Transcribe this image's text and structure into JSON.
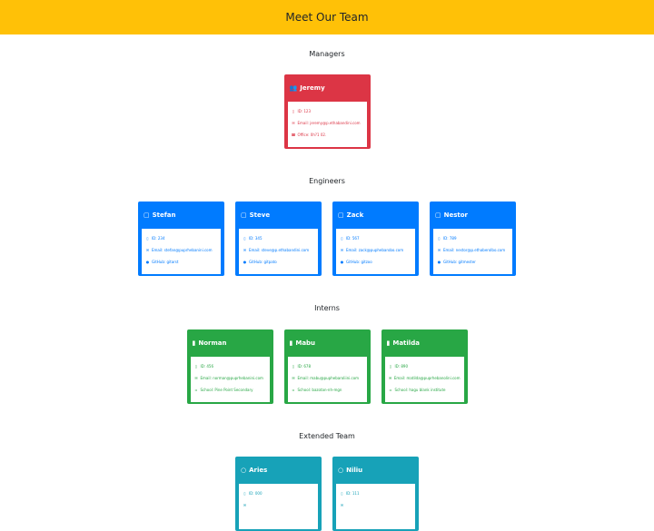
{
  "header": {
    "title": "Meet Our Team"
  },
  "sections": {
    "managers": {
      "title": "Managers",
      "cards": [
        {
          "name": "Jeremy",
          "id": "ID: 123",
          "email": "Email: jeremy@p.ethabandini.com",
          "extra": "Office: 0h?1 02."
        }
      ]
    },
    "engineers": {
      "title": "Engineers",
      "cards": [
        {
          "name": "Stefan",
          "id": "ID: 234",
          "email": "Email: stefan@puprhebanini.com",
          "extra": "GitHub: gitarst"
        },
        {
          "name": "Steve",
          "id": "ID: 345",
          "email": "Email: steve@p.ethabandini.com",
          "extra": "GitHub: gitpato"
        },
        {
          "name": "Zack",
          "id": "ID: 567",
          "email": "Email: zack@puphebarobo.com",
          "extra": "GitHub: gitzoo"
        },
        {
          "name": "Nestor",
          "id": "ID: 789",
          "email": "Email: nestor@p.ethaberolbo.com",
          "extra": "GitHub: gitmester"
        }
      ]
    },
    "interns": {
      "title": "Interns",
      "cards": [
        {
          "name": "Norman",
          "id": "ID: 456",
          "email": "Email: norman@puprhebanini.com",
          "extra": "School: Pine Point Secondary"
        },
        {
          "name": "Mabu",
          "id": "ID: 678",
          "email": "Email: mabu@puphebaroliini.com",
          "extra": "School: bazotan-nh-mgn"
        },
        {
          "name": "Matilda",
          "id": "ID: 890",
          "email": "Email: matilda@puprhebanolini.com",
          "extra": "School: hagu blank institute"
        }
      ]
    },
    "extended": {
      "title": "Extended Team",
      "cards": [
        {
          "name": "Aries",
          "id": "ID: 000",
          "email": "",
          "extra": ""
        },
        {
          "name": "Niliu",
          "id": "ID: 111",
          "email": "",
          "extra": ""
        }
      ]
    }
  },
  "colors": {
    "header": "#ffc107",
    "manager": "#dc3545",
    "engineer": "#007bff",
    "intern": "#28a745",
    "extended": "#17a2b8"
  },
  "icons": {
    "manager": "users-icon",
    "engineer": "file-code-icon",
    "intern": "bookmark-icon",
    "extended": "user-icon",
    "id": "id-badge-icon",
    "email": "envelope-icon",
    "office": "phone-icon",
    "github": "github-icon",
    "school": "school-icon"
  }
}
